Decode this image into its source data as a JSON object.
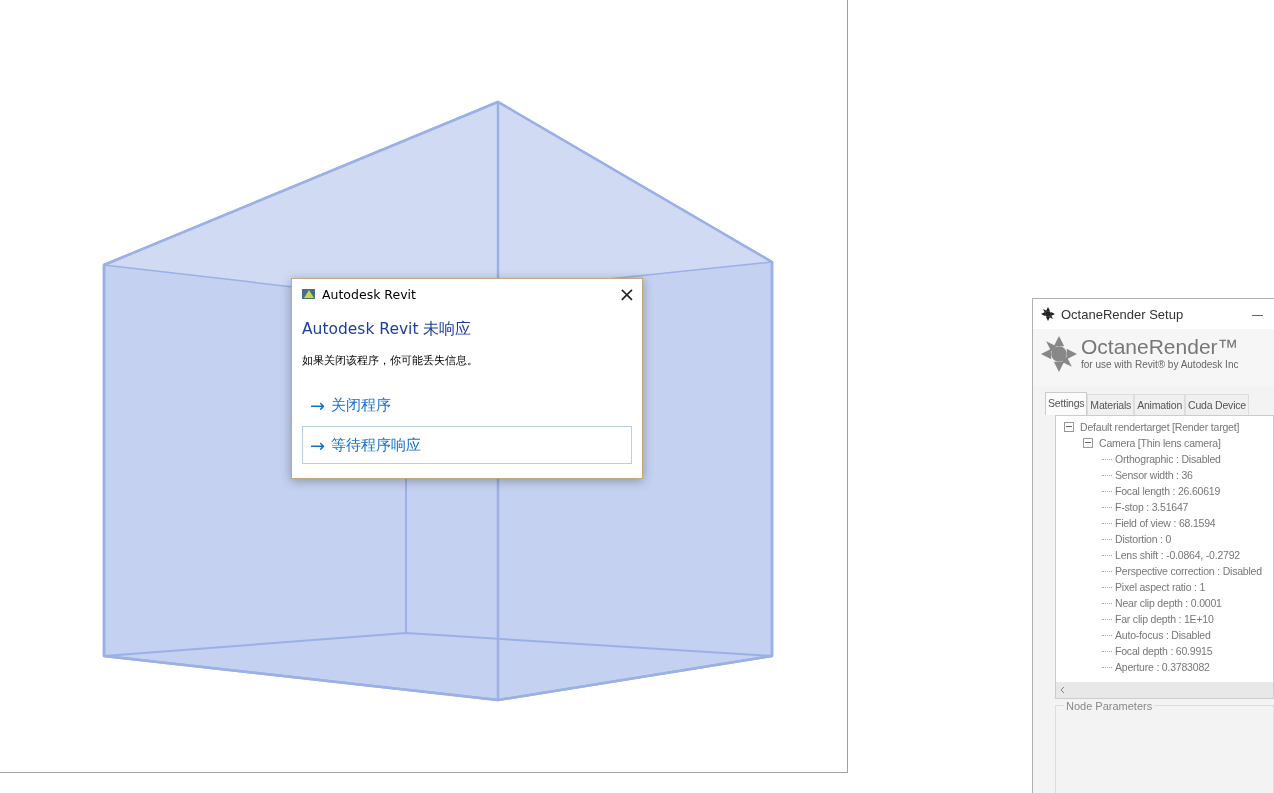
{
  "dialog": {
    "title": "Autodesk Revit",
    "heading": "Autodesk Revit 未响应",
    "message": "如果关闭该程序，你可能丢失信息。",
    "close": "×",
    "options": [
      {
        "arrow": "→",
        "label": "关闭程序",
        "focused": false
      },
      {
        "arrow": "→",
        "label": "等待程序响应",
        "focused": true
      }
    ]
  },
  "octane": {
    "title": "OctaneRender Setup",
    "minimize": "—",
    "logo": "OctaneRender™",
    "subtitle": "for use with Revit® by Autodesk Inc",
    "tabs": [
      {
        "label": "Settings",
        "selected": true
      },
      {
        "label": "Materials",
        "selected": false
      },
      {
        "label": "Animation",
        "selected": false
      },
      {
        "label": "Cuda Device",
        "selected": false
      }
    ],
    "tree": [
      {
        "label": "Default rendertarget  [Render target]",
        "expanded": true,
        "children": [
          {
            "label": "Camera  [Thin lens camera]",
            "expanded": true,
            "children": [
              {
                "label": "Orthographic : Disabled"
              },
              {
                "label": "Sensor width : 36"
              },
              {
                "label": "Focal length : 26.60619"
              },
              {
                "label": "F-stop : 3.51647"
              },
              {
                "label": "Field of view : 68.1594"
              },
              {
                "label": "Distortion : 0"
              },
              {
                "label": "Lens shift : -0.0864, -0.2792"
              },
              {
                "label": "Perspective correction : Disabled"
              },
              {
                "label": "Pixel aspect ratio : 1"
              },
              {
                "label": "Near clip depth : 0.0001"
              },
              {
                "label": "Far clip depth : 1E+10"
              },
              {
                "label": "Auto-focus : Disabled"
              },
              {
                "label": "Focal depth : 60.9915"
              },
              {
                "label": "Aperture : 0.3783082"
              }
            ]
          }
        ]
      }
    ],
    "node_parameters": "Node Parameters"
  }
}
